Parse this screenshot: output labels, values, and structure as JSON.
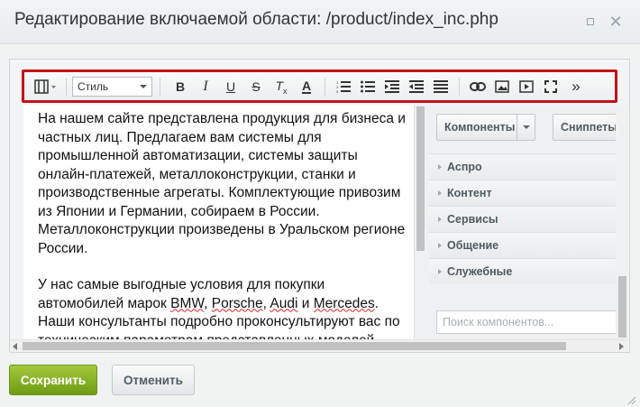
{
  "window": {
    "title": "Редактирование включаемой области: /product/index_inc.php"
  },
  "toolbar": {
    "style_select": "Стиль",
    "more": "»"
  },
  "content": {
    "paragraph1": "На нашем сайте представлена продукция для бизнеса и частных лиц. Предлагаем вам системы для промышленной автоматизации, системы защиты онлайн-платежей, металлоконструкции, станки и производственные агрегаты. Комплектующие привозим из Японии и Германии, собираем в России. Металлоконструкции произведены в Уральском регионе России.",
    "p2_start": "У нас самые выгодные условия для покупки автомобилей марок ",
    "brand1": "BMW",
    "sep1": ", ",
    "brand2": "Porsche",
    "sep2": ", ",
    "brand3": "Audi",
    "and": " и ",
    "brand4": "Mercedes",
    "p2_end": ". Наши консультанты подробно проконсультируют вас по техническим параметрам представленных моделей"
  },
  "panel": {
    "components_button": "Компоненты",
    "snippets_button": "Сниппеты",
    "categories": [
      "Аспро",
      "Контент",
      "Сервисы",
      "Общение",
      "Служебные"
    ],
    "search_placeholder": "Поиск компонентов..."
  },
  "footer": {
    "save_label": "Сохранить",
    "cancel_label": "Отменить"
  },
  "colors": {
    "toolbar_highlight": "#c3121a",
    "save_button": "#7aa61c"
  }
}
